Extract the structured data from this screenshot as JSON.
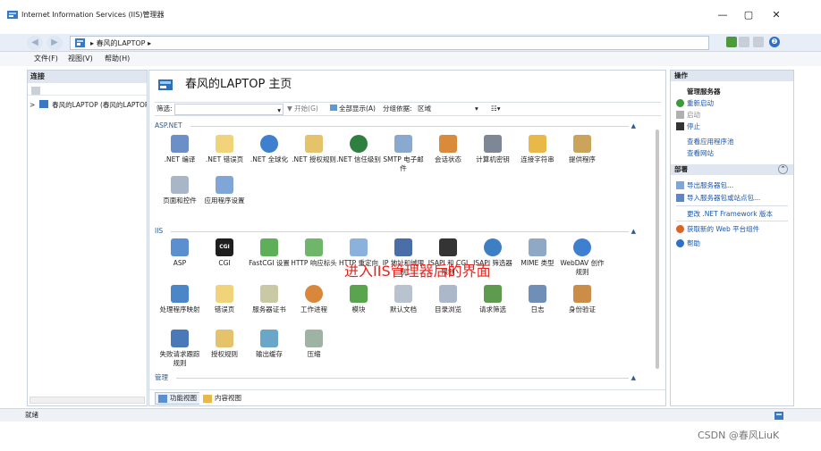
{
  "window": {
    "title": "Internet Information Services (IIS)管理器",
    "controls": {
      "minimize": "—",
      "maximize": "▢",
      "close": "✕"
    }
  },
  "addressbar": {
    "back": "◀",
    "forward": "▶",
    "path_sep": "▸",
    "path": "春风的LAPTOP",
    "path_end": "▸",
    "help_label": "❷"
  },
  "menubar": {
    "items": [
      "文件(F)",
      "视图(V)",
      "帮助(H)"
    ]
  },
  "connections": {
    "title": "连接",
    "tree_expander": ">",
    "tree_item": "春风的LAPTOP (春风的LAPTOP"
  },
  "center": {
    "home_title": "春风的LAPTOP 主页",
    "filter": {
      "label": "筛选:",
      "dropdown": "▾",
      "start": "▼ 开始(G)",
      "show_all": "全部显示(A)",
      "group_by_label": "分组依据:",
      "group_by_value": "区域",
      "view_button": "☷▾"
    },
    "groups": [
      {
        "name": "ASP.NET",
        "items": [
          ".NET 编译",
          ".NET 错误页",
          ".NET 全球化",
          ".NET 授权规则",
          ".NET 信任级别",
          "SMTP 电子邮件",
          "会话状态",
          "计算机密钥",
          "连接字符串",
          "提供程序",
          "页面和控件",
          "应用程序设置"
        ]
      },
      {
        "name": "IIS",
        "items": [
          "ASP",
          "CGI",
          "FastCGI 设置",
          "HTTP 响应标头",
          "HTTP 重定向",
          "IP 地址和域限制",
          "ISAPI 和 CGI 限制",
          "ISAPI 筛选器",
          "MIME 类型",
          "WebDAV 创作规则",
          "处理程序映射",
          "错误页",
          "服务器证书",
          "工作进程",
          "模块",
          "默认文档",
          "目录浏览",
          "请求筛选",
          "日志",
          "身份验证",
          "失败请求跟踪规则",
          "授权规则",
          "输出缓存",
          "压缩"
        ]
      },
      {
        "name": "管理",
        "items": []
      }
    ],
    "cgi_badge": "CGI",
    "chevron": "▲",
    "overlay_annotation": "进入IIS管理器后的界面",
    "tabs": [
      "功能视图",
      "内容视图"
    ]
  },
  "actions": {
    "title": "操作",
    "manage_server": "管理服务器",
    "restart": "重新启动",
    "start": "启动",
    "stop": "停止",
    "view_app_pools": "查看应用程序池",
    "view_sites": "查看网站",
    "deploy_title": "部署",
    "export_package": "导出服务器包...",
    "import_package": "导入服务器包或站点包...",
    "change_framework": "更改 .NET Framework 版本",
    "get_web_platform": "获取新的 Web 平台组件",
    "help": "帮助",
    "collapse": "⌃"
  },
  "statusbar": {
    "text": "就绪"
  },
  "watermark": "CSDN @春风LiuK",
  "colors": {
    "link": "#1a56b0",
    "group_header": "#2a5a9a",
    "annotation": "#e8231c",
    "pane_header": "#dfe6ef"
  }
}
